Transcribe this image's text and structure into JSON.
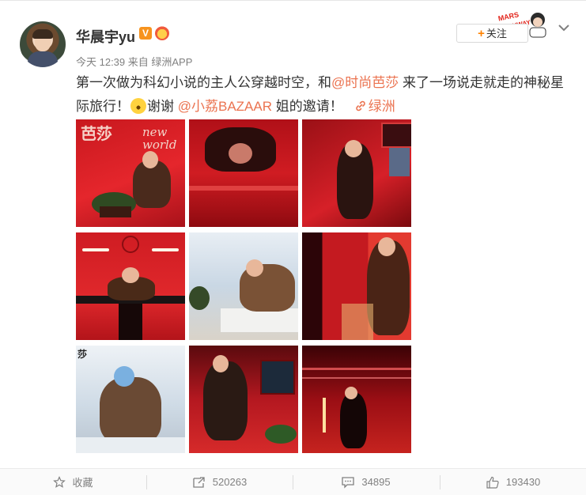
{
  "post": {
    "username": "华晨宇yu",
    "verified_badge": "V",
    "time_source": "今天 12:39 来自 绿洲APP",
    "follow_label": "关注",
    "text_1": "第一次做为科幻小说的主人公穿越时空，和",
    "mention_1": "@时尚芭莎",
    "text_2": " 来了一场说走就走的神秘星际旅行！",
    "text_3": "谢谢 ",
    "mention_2": "@小荔BAZAAR",
    "text_4": " 姐的邀请！",
    "location_link": "绿洲",
    "cover_title": "芭莎",
    "cover_subtitle_1": "new",
    "cover_subtitle_2": "world"
  },
  "actions": {
    "favorite_label": "收藏",
    "repost_count": "520263",
    "comment_count": "34895",
    "like_count": "193430"
  },
  "colors": {
    "accent": "#eb7350",
    "follow_plus": "#ff8200",
    "vip": "#f7931e"
  },
  "icons": [
    "chevron-down-icon",
    "link-icon",
    "star-icon",
    "repost-icon",
    "comment-icon",
    "like-icon"
  ]
}
